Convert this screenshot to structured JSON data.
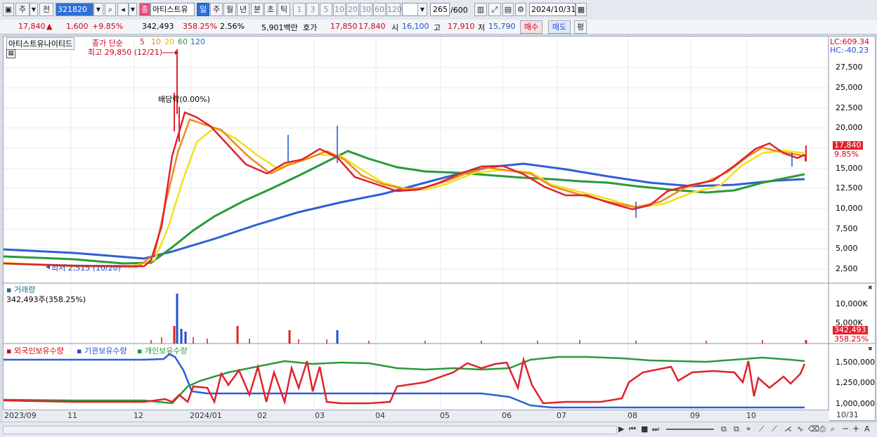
{
  "toolbar": {
    "main_label": "주",
    "prev_label": "전",
    "code": "321820",
    "stock_name": "아티스트유",
    "name_badge": "종",
    "periods": [
      "일",
      "주",
      "월",
      "년",
      "분",
      "초",
      "틱"
    ],
    "active_period": "일",
    "intervals": [
      "1",
      "3",
      "5",
      "10",
      "20",
      "30",
      "60",
      "120"
    ],
    "count": "265",
    "count_max": "/600",
    "date": "2024/10/31"
  },
  "quote": {
    "price": "17,840",
    "arrow": "▲",
    "change": "1,600",
    "change_pct": "+9.85%",
    "volume": "342,493",
    "volume_pct": "358.25%",
    "turnover": "2.56%",
    "amount": "5,901백만",
    "bid_label": "호가",
    "bid1": "17,850",
    "bid2": "17,840",
    "open_label": "시",
    "open": "16,100",
    "high_label": "고",
    "high": "17,910",
    "low_label": "저",
    "low": "15,790",
    "buy_label": "매수",
    "sell_label": "매도",
    "eval_label": "평"
  },
  "price_panel": {
    "title": "아티스트유나이티드",
    "ma_label": "종가 단순",
    "ma_periods": [
      "5",
      "10",
      "20",
      "60",
      "120"
    ],
    "ma_colors": [
      "#e0222b",
      "#f08a1c",
      "#f2e01a",
      "#2a9a3a",
      "#2f5fd6"
    ],
    "high_note": "최고 29,850 (12/21)",
    "low_note": "최저 2,515 (10/20)",
    "dividend_note": "배당락(0.00%)",
    "lc": "LC:609.34",
    "hc": "HC:-40.23",
    "y_ticks": [
      "27,500",
      "25,000",
      "22,500",
      "20,000",
      "17,500",
      "15,000",
      "12,500",
      "10,000",
      "7,500",
      "5,000",
      "2,500"
    ],
    "last_price_tag": "17,840",
    "last_pct_tag": "9.85%"
  },
  "volume_panel": {
    "title": "거래량",
    "value_text": "342,493주(358.25%)",
    "y_ticks": [
      "10,000K",
      "5,000K"
    ],
    "last_tag": "342,493",
    "last_pct": "358.25%"
  },
  "holding_panel": {
    "foreign": "외국인보유수량",
    "institution": "기관보유수량",
    "individual": "개인보유수량",
    "y_ticks": [
      "1,500,000",
      "1,250,000",
      "1,000,000"
    ]
  },
  "x_axis": [
    "2023/09",
    "11",
    "12",
    "2024/01",
    "02",
    "03",
    "04",
    "05",
    "06",
    "07",
    "08",
    "09",
    "10",
    "10/31"
  ]
}
